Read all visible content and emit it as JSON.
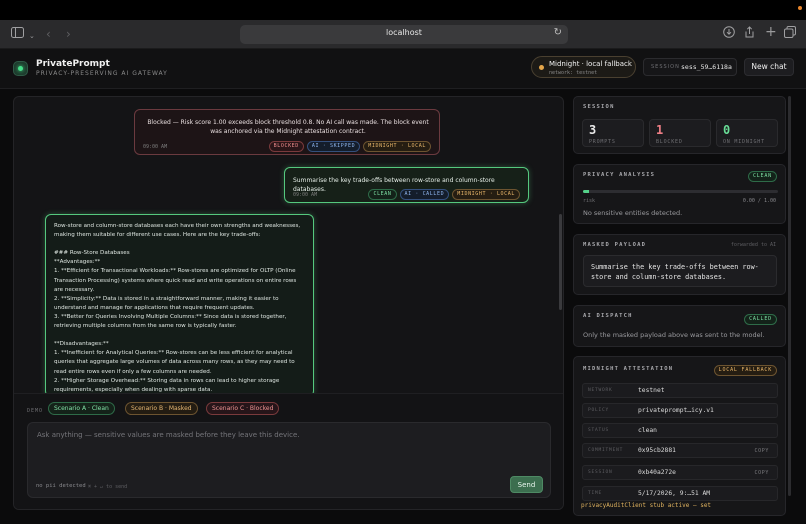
{
  "browser": {
    "url": "localhost"
  },
  "header": {
    "app_name": "PrivatePrompt",
    "app_subtitle": "PRIVACY-PRESERVING AI GATEWAY",
    "midnight_label": "Midnight · local fallback",
    "midnight_network": "network: testnet",
    "session_key": "SESSION",
    "session_value": "sess_59…6118a",
    "new_chat_label": "New chat"
  },
  "chat": {
    "messages": [
      {
        "kind": "system-blocked",
        "text": "Blocked — Risk score 1.00 exceeds block threshold 0.8. No AI call was made. The block event was anchored via the Midnight attestation contract.",
        "time": "09:00 AM",
        "tags": [
          "BLOCKED",
          "AI · SKIPPED",
          "MIDNIGHT · LOCAL"
        ]
      },
      {
        "kind": "user",
        "text": "Summarise the key trade-offs between row-store and column-store databases.",
        "time": "09:00 AM",
        "tags": [
          "CLEAN",
          "AI · CALLED",
          "MIDNIGHT · LOCAL"
        ]
      },
      {
        "kind": "assistant",
        "text": "Row-store and column-store databases each have their own strengths and weaknesses, making them suitable for different use cases. Here are the key trade-offs:\n\n### Row-Store Databases\n**Advantages:**\n1. **Efficient for Transactional Workloads:** Row-stores are optimized for OLTP (Online Transaction Processing) systems where quick read and write operations on entire rows are necessary.\n2. **Simplicity:** Data is stored in a straightforward manner, making it easier to understand and manage for applications that require frequent updates.\n3. **Better for Queries Involving Multiple Columns:** Since data is stored together, retrieving multiple columns from the same row is typically faster.\n\n**Disadvantages:**\n1. **Inefficient for Analytical Queries:** Row-stores can be less efficient for analytical queries that aggregate large volumes of data across many rows, as they may need to read entire rows even if only a few columns are needed.\n2. **Higher Storage Overhead:** Storing data in rows can lead to higher storage requirements, especially when dealing with sparse data."
      }
    ],
    "demo_label": "DEMO",
    "scenarios": [
      "Scenario A · Clean",
      "Scenario B · Masked",
      "Scenario C · Blocked"
    ],
    "input_placeholder": "Ask anything — sensitive values are masked before they leave this device.",
    "pii_status": "no pii detected",
    "send_hint": "⌘ + ↵ to send",
    "send_label": "Send"
  },
  "sidebar": {
    "session": {
      "title": "SESSION",
      "stats": [
        {
          "value": "3",
          "label": "PROMPTS",
          "color": "#e9e9e9"
        },
        {
          "value": "1",
          "label": "BLOCKED",
          "color": "#ef7f86"
        },
        {
          "value": "0",
          "label": "ON MIDNIGHT",
          "color": "#68dc96"
        }
      ]
    },
    "privacy": {
      "title": "PRIVACY ANALYSIS",
      "badge": "CLEAN",
      "risk_label": "risk",
      "risk_value": "0.00 / 1.00",
      "risk_fraction": 0.03,
      "note": "No sensitive entities detected."
    },
    "masked": {
      "title": "MASKED PAYLOAD",
      "forwarded": "forwarded to AI",
      "text": "Summarise the key trade-offs between row-store and column-store databases."
    },
    "dispatch": {
      "title": "AI DISPATCH",
      "badge": "CALLED",
      "note": "Only the masked payload above was sent to the model."
    },
    "attestation": {
      "title": "MIDNIGHT ATTESTATION",
      "badge": "LOCAL FALLBACK",
      "rows": [
        {
          "key": "NETWORK",
          "value": "testnet",
          "copy": ""
        },
        {
          "key": "POLICY",
          "value": "privateprompt…icy.v1",
          "copy": ""
        },
        {
          "key": "STATUS",
          "value": "clean",
          "copy": ""
        },
        {
          "key": "COMMITMENT",
          "value": "0x95cb2881",
          "copy": "COPY"
        },
        {
          "key": "SESSION",
          "value": "0xb40a272e",
          "copy": "COPY"
        },
        {
          "key": "TIME",
          "value": "5/17/2026, 9:…51 AM",
          "copy": ""
        }
      ],
      "audit_line": "privacyAuditClient stub active — set"
    }
  }
}
